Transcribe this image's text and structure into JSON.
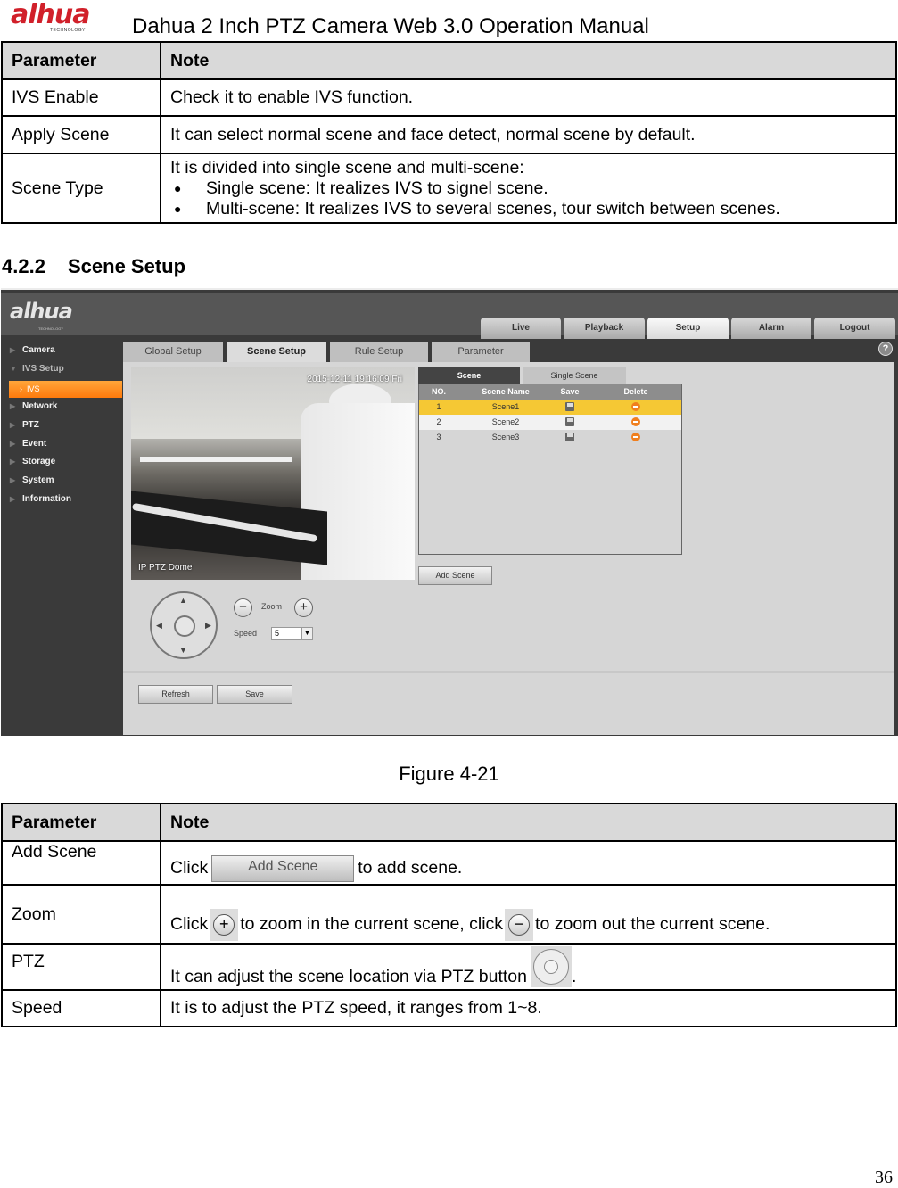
{
  "header": {
    "brand": "alhua",
    "brand_sub": "TECHNOLOGY",
    "title": "Dahua 2 Inch PTZ Camera Web 3.0 Operation Manual"
  },
  "table1": {
    "headers": [
      "Parameter",
      "Note"
    ],
    "rows": [
      {
        "param": "IVS Enable",
        "note": "Check it to enable IVS function."
      },
      {
        "param": "Apply Scene",
        "note": "It can select normal scene and face detect, normal scene by default."
      },
      {
        "param": "Scene Type",
        "note": "It is divided into single scene and multi-scene:",
        "bullets": [
          "Single scene: It realizes IVS to signel scene.",
          "Multi-scene:  It realizes IVS to several scenes, tour switch between scenes."
        ]
      }
    ]
  },
  "section": {
    "number": "4.2.2",
    "title": "Scene Setup"
  },
  "screenshot": {
    "logo": "alhua",
    "logo_sub": "TECHNOLOGY",
    "nav_tabs": [
      "Live",
      "Playback",
      "Setup",
      "Alarm",
      "Logout"
    ],
    "active_nav": "Setup",
    "sidebar": [
      "Camera",
      "IVS Setup",
      "IVS",
      "Network",
      "PTZ",
      "Event",
      "Storage",
      "System",
      "Information"
    ],
    "sub_tabs": [
      "Global Setup",
      "Scene Setup",
      "Rule Setup",
      "Parameter"
    ],
    "active_sub_tab": "Scene Setup",
    "help_glyph": "?",
    "video": {
      "timestamp": "2015-12-11 19:16:09 Fri",
      "name": "IP PTZ Dome"
    },
    "scene_tabs": [
      "Scene",
      "Single Scene"
    ],
    "scene_table": {
      "headers": [
        "NO.",
        "Scene Name",
        "Save",
        "Delete"
      ],
      "rows": [
        {
          "no": "1",
          "name": "Scene1"
        },
        {
          "no": "2",
          "name": "Scene2"
        },
        {
          "no": "3",
          "name": "Scene3"
        }
      ]
    },
    "add_scene": "Add Scene",
    "zoom_label": "Zoom",
    "zoom_out": "−",
    "zoom_in": "+",
    "speed_label": "Speed",
    "speed_value": "5",
    "refresh": "Refresh",
    "save": "Save",
    "colors": {
      "selected_row": "#f5c834",
      "sidebar_active": "#ff8c1a",
      "delete": "#f07f1e"
    }
  },
  "caption": "Figure 4-21",
  "table2": {
    "headers": [
      "Parameter",
      "Note"
    ],
    "rows": [
      {
        "param": "Add Scene",
        "pre": "Click",
        "btn": "Add Scene",
        "post": "to add scene."
      },
      {
        "param": "Zoom",
        "pre": "Click",
        "mid": "to zoom in the current scene, click",
        "post": "to zoom out the current scene."
      },
      {
        "param": "PTZ",
        "pre": "It can adjust the scene location via PTZ button",
        "post": "."
      },
      {
        "param": "Speed",
        "note": "It is to adjust the PTZ speed, it ranges from 1~8."
      }
    ]
  },
  "page_number": "36"
}
